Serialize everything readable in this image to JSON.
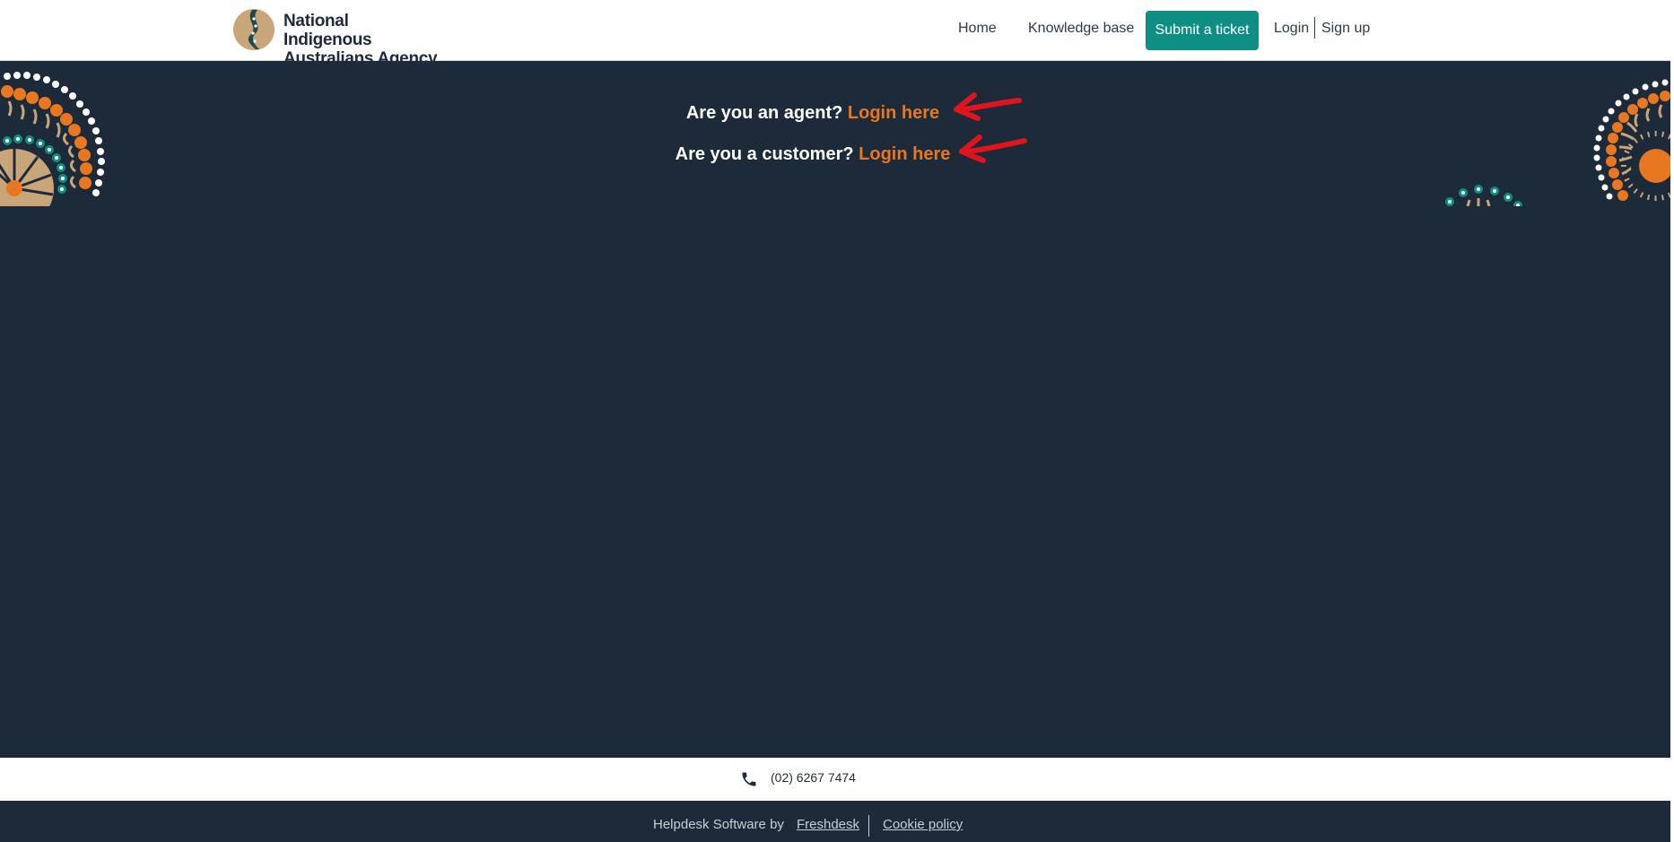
{
  "header": {
    "logo_line1": "National Indigenous",
    "logo_line2": "Australians Agency",
    "nav": {
      "home": "Home",
      "knowledge_base": "Knowledge base",
      "submit_ticket": "Submit a ticket",
      "login": "Login",
      "signup": "Sign up"
    }
  },
  "hero": {
    "agent_prompt": "Are you an agent?",
    "agent_link": "Login here",
    "customer_prompt": "Are you a customer?",
    "customer_link": "Login here"
  },
  "footer": {
    "phone": "(02) 6267 7474",
    "helpdesk_prefix": "Helpdesk Software by",
    "freshdesk_link": "Freshdesk",
    "cookie_link": "Cookie policy"
  },
  "colors": {
    "background": "#1c2a39",
    "accent_orange": "#e87722",
    "button_teal": "#0f8f83",
    "arrow_red": "#e0141c"
  },
  "icons": {
    "phone": "phone-icon",
    "arrow": "red-arrow-annotation"
  }
}
